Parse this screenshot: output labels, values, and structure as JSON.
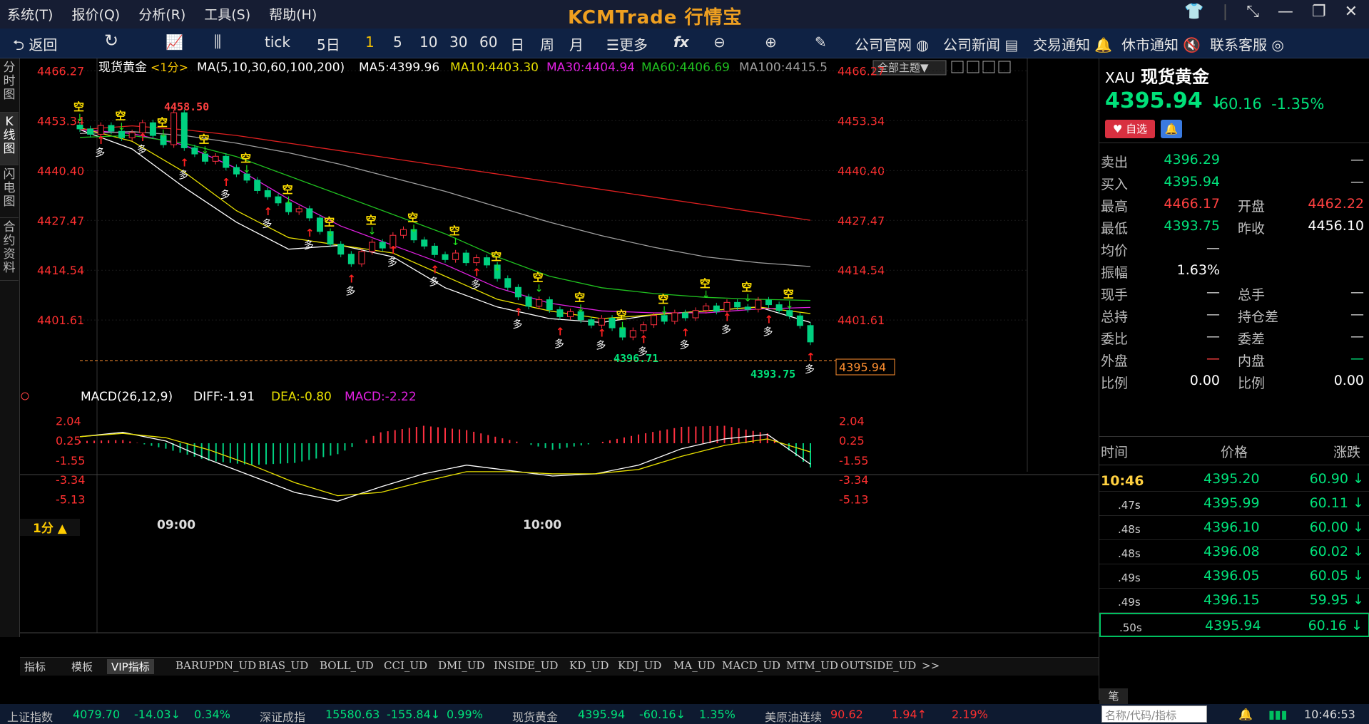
{
  "menu": [
    "系统(T)",
    "报价(Q)",
    "分析(R)",
    "工具(S)",
    "帮助(H)"
  ],
  "brand": "KCMTrade 行情宝",
  "toolbar": {
    "back": "返回",
    "periods": [
      "tick",
      "5日",
      "1",
      "5",
      "10",
      "30",
      "60",
      "日",
      "周",
      "月"
    ],
    "active_period": "1",
    "more": "更多",
    "links": [
      "公司官网",
      "公司新闻",
      "交易通知",
      "休市通知",
      "联系客服"
    ]
  },
  "left_tabs": [
    "分时图",
    "K线图",
    "闪电图",
    "合约资料"
  ],
  "ma_legend": {
    "symbol": "现货黄金",
    "period": "<1分>",
    "ma_title": "MA(5,10,30,60,100,200)",
    "ma5": "MA5:4399.96",
    "ma10": "MA10:4403.30",
    "ma30": "MA30:4404.94",
    "ma60": "MA60:4406.69",
    "ma100": "MA100:4415.5",
    "theme_btn": "全部主题▼"
  },
  "macd_legend": {
    "title": "MACD(26,12,9)",
    "diff": "DIFF:-1.91",
    "dea": "DEA:-0.80",
    "macd": "MACD:-2.22"
  },
  "price_axis": [
    "4466.27",
    "4453.34",
    "4440.40",
    "4427.47",
    "4414.54",
    "4401.61"
  ],
  "macd_axis": [
    "2.04",
    "0.25",
    "-1.55",
    "-3.34",
    "-5.13"
  ],
  "time_axis": [
    "09:00",
    "10:00"
  ],
  "annotations": {
    "high": "4458.50",
    "low1": "4396.71",
    "low2": "4393.75",
    "current_price_tag": "4395.94"
  },
  "period_selector": "1分 ▲",
  "chart_data": {
    "type": "candlestick",
    "symbol": "现货黄金",
    "interval": "1分",
    "ylim": [
      4390,
      4468
    ],
    "high": 4458.5,
    "low": 4393.75,
    "last": 4395.94,
    "closes": [
      4451.2,
      4449.8,
      4452.1,
      4450.6,
      4448.9,
      4450.2,
      4452.8,
      4449.5,
      4447.1,
      4455.4,
      4446.3,
      4444.7,
      4442.8,
      4444.1,
      4441.2,
      4439.5,
      4437.9,
      4435.2,
      4433.6,
      4432.0,
      4429.7,
      4430.5,
      4428.1,
      4424.6,
      4421.3,
      4418.7,
      4416.2,
      4419.4,
      4421.8,
      4420.3,
      4423.6,
      4425.1,
      4422.4,
      4420.8,
      4418.6,
      4417.3,
      4419.0,
      4416.5,
      4417.8,
      4415.9,
      4412.4,
      4410.1,
      4407.6,
      4405.2,
      4406.9,
      4404.3,
      4402.5,
      4403.8,
      4401.7,
      4400.3,
      4402.1,
      4399.6,
      4397.2,
      4398.9,
      4400.4,
      4402.8,
      4401.3,
      4403.5,
      4402.2,
      4404.1,
      4405.3,
      4403.9,
      4406.2,
      4405.0,
      4404.4,
      4406.8,
      4405.6,
      4404.1,
      4402.7,
      4400.2,
      4395.94
    ],
    "ma_lines": [
      {
        "name": "MA5",
        "color": "#ffffff",
        "values": [
          4451.0,
          4446.0,
          4436.0,
          4427.0,
          4420.0,
          4421.0,
          4418.0,
          4410.0,
          4405.0,
          4402.0,
          4401.0,
          4403.0,
          4404.0,
          4405.0,
          4401.0
        ]
      },
      {
        "name": "MA10",
        "color": "#e8e000",
        "values": [
          4451.5,
          4448.0,
          4440.0,
          4430.0,
          4423.0,
          4421.0,
          4419.0,
          4413.0,
          4407.0,
          4404.0,
          4402.0,
          4403.0,
          4404.0,
          4405.0,
          4403.3
        ]
      },
      {
        "name": "MA30",
        "color": "#e020e0",
        "values": [
          4451.0,
          4450.0,
          4447.0,
          4441.0,
          4433.0,
          4426.0,
          4421.0,
          4416.0,
          4410.0,
          4406.0,
          4404.0,
          4403.5,
          4403.5,
          4404.5,
          4404.9
        ]
      },
      {
        "name": "MA60",
        "color": "#20c020",
        "values": [
          4449.0,
          4449.5,
          4447.5,
          4444.0,
          4439.0,
          4434.0,
          4429.0,
          4424.0,
          4418.0,
          4413.0,
          4410.0,
          4408.5,
          4407.5,
          4407.0,
          4406.7
        ]
      },
      {
        "name": "MA100",
        "color": "#a0a0a0",
        "values": [
          4450.0,
          4450.5,
          4449.5,
          4447.5,
          4445.0,
          4442.0,
          4438.5,
          4435.0,
          4431.0,
          4427.0,
          4423.5,
          4420.5,
          4418.0,
          4416.5,
          4415.5
        ]
      },
      {
        "name": "MA200",
        "color": "#e02020",
        "values": [
          4451.0,
          4452.0,
          4451.0,
          4449.5,
          4447.5,
          4445.5,
          4443.5,
          4441.5,
          4439.5,
          4437.5,
          4435.5,
          4433.5,
          4431.5,
          4429.5,
          4427.5
        ]
      }
    ],
    "macd": {
      "diff": [
        0.6,
        1.0,
        0.2,
        -1.5,
        -3.0,
        -4.5,
        -5.3,
        -4.0,
        -2.8,
        -2.0,
        -2.5,
        -3.0,
        -2.8,
        -2.0,
        -0.5,
        0.4,
        0.8,
        -1.91
      ],
      "dea": [
        0.6,
        0.9,
        0.5,
        -0.6,
        -2.0,
        -3.6,
        -4.8,
        -4.5,
        -3.5,
        -2.6,
        -2.6,
        -2.8,
        -2.8,
        -2.4,
        -1.2,
        -0.2,
        0.4,
        -0.8
      ],
      "hist": [
        0.2,
        0.3,
        -0.5,
        -1.6,
        -2.0,
        -1.8,
        -1.0,
        1.0,
        1.6,
        1.2,
        0.3,
        -0.6,
        0.0,
        0.8,
        1.5,
        1.6,
        0.9,
        -2.22
      ]
    }
  },
  "quote": {
    "code": "XAU",
    "name": "现货黄金",
    "price": "4395.94",
    "arrow": "↓",
    "change": "-60.16",
    "change_pct": "-1.35%",
    "watch_btn": "自选",
    "rows": [
      {
        "l1": "卖出",
        "v1": "4396.29",
        "l2": "",
        "v2": "—",
        "c1": "#00e17a"
      },
      {
        "l1": "买入",
        "v1": "4395.94",
        "l2": "",
        "v2": "—",
        "c1": "#00e17a"
      },
      {
        "l1": "最高",
        "v1": "4466.17",
        "l2": "开盘",
        "v2": "4462.22",
        "c1": "#ff4040",
        "c2": "#ff4040"
      },
      {
        "l1": "最低",
        "v1": "4393.75",
        "l2": "昨收",
        "v2": "4456.10",
        "c1": "#00e17a",
        "c2": "#ffffff"
      },
      {
        "l1": "均价",
        "v1": "—",
        "l2": "",
        "v2": ""
      },
      {
        "l1": "振幅",
        "v1": "1.63%",
        "l2": "",
        "v2": "",
        "c1": "#ffffff"
      },
      {
        "l1": "现手",
        "v1": "—",
        "l2": "总手",
        "v2": "—"
      },
      {
        "l1": "总持",
        "v1": "—",
        "l2": "持仓差",
        "v2": "—"
      },
      {
        "l1": "委比",
        "v1": "—",
        "l2": "委差",
        "v2": "—"
      },
      {
        "l1": "外盘",
        "v1": "—",
        "l2": "内盘",
        "v2": "—",
        "c1": "#ff4040",
        "c2": "#00e17a"
      },
      {
        "l1": "比例",
        "v1": "0.00",
        "l2": "比例",
        "v2": "0.00",
        "c1": "#ffffff",
        "c2": "#ffffff"
      }
    ],
    "tick_header": [
      "时间",
      "价格",
      "涨跌"
    ],
    "ticks": [
      {
        "t": "10:46",
        "p": "4395.20",
        "c": "60.90"
      },
      {
        "t": ".47s",
        "p": "4395.99",
        "c": "60.11"
      },
      {
        "t": ".48s",
        "p": "4396.10",
        "c": "60.00"
      },
      {
        "t": ".48s",
        "p": "4396.08",
        "c": "60.02"
      },
      {
        "t": ".49s",
        "p": "4396.05",
        "c": "60.05"
      },
      {
        "t": ".49s",
        "p": "4396.15",
        "c": "59.95"
      },
      {
        "t": ".50s",
        "p": "4395.94",
        "c": "60.16"
      }
    ],
    "pen_tab": "笔"
  },
  "bottom_tabs": [
    "指标",
    "模板",
    "VIP指标",
    "BARUPDN_UD",
    "BIAS_UD",
    "BOLL_UD",
    "CCI_UD",
    "DMI_UD",
    "INSIDE_UD",
    "KD_UD",
    "KDJ_UD",
    "MA_UD",
    "MACD_UD",
    "MTM_UD",
    "OUTSIDE_UD",
    ">>"
  ],
  "status": {
    "items": [
      {
        "name": "上证指数",
        "v": "4079.70",
        "c": "-14.03↓",
        "p": "0.34%",
        "color": "#00e17a"
      },
      {
        "name": "深证成指",
        "v": "15580.63",
        "c": "-155.84↓",
        "p": "0.99%",
        "color": "#00e17a"
      },
      {
        "name": "现货黄金",
        "v": "4395.94",
        "c": "-60.16↓",
        "p": "1.35%",
        "color": "#00e17a"
      },
      {
        "name": "美原油连续",
        "v": "90.62",
        "c": "1.94↑",
        "p": "2.19%",
        "color": "#ff3030"
      }
    ],
    "search_placeholder": "名称/代码/指标",
    "clock": "10:46:53"
  }
}
